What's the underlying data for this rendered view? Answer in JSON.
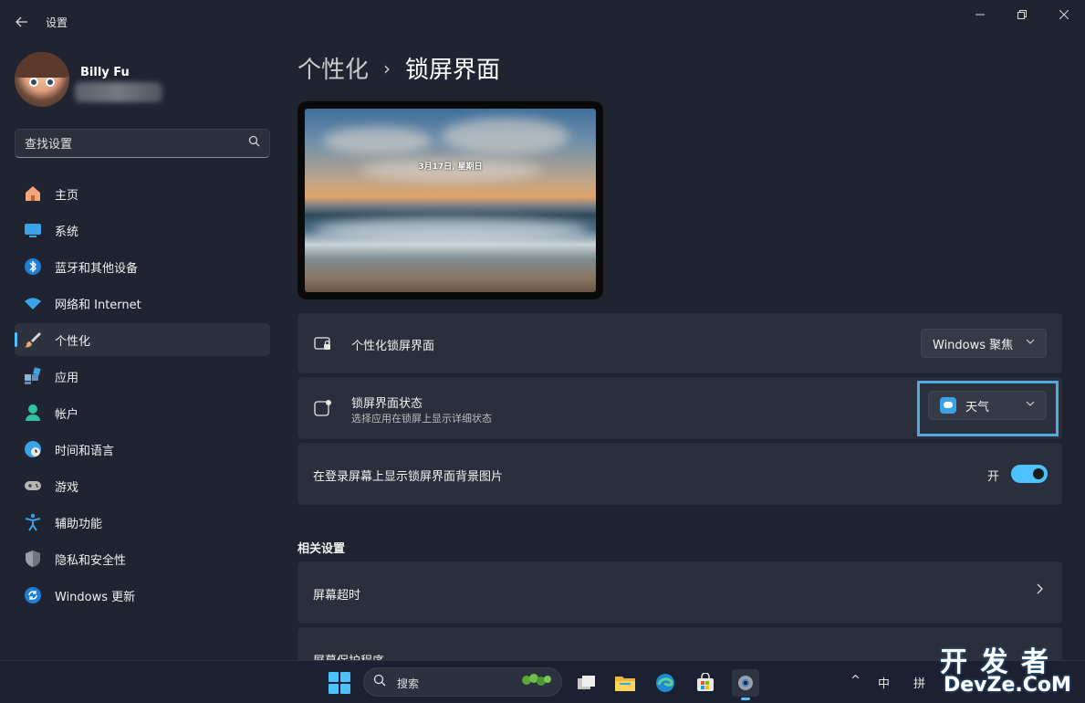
{
  "window": {
    "title": "设置",
    "back_icon": "arrow-left-icon",
    "minimize_icon": "minimize-icon",
    "maximize_icon": "restore-icon",
    "close_icon": "close-icon"
  },
  "user": {
    "name": "Billy Fu"
  },
  "search": {
    "placeholder": "查找设置",
    "icon": "search-icon"
  },
  "sidebar": {
    "items": [
      {
        "label": "主页",
        "icon": "home-icon"
      },
      {
        "label": "系统",
        "icon": "monitor-icon"
      },
      {
        "label": "蓝牙和其他设备",
        "icon": "bluetooth-icon"
      },
      {
        "label": "网络和 Internet",
        "icon": "wifi-icon"
      },
      {
        "label": "个性化",
        "icon": "brush-icon",
        "active": true
      },
      {
        "label": "应用",
        "icon": "apps-icon"
      },
      {
        "label": "帐户",
        "icon": "person-icon"
      },
      {
        "label": "时间和语言",
        "icon": "globe-clock-icon"
      },
      {
        "label": "游戏",
        "icon": "gamepad-icon"
      },
      {
        "label": "辅助功能",
        "icon": "accessibility-icon"
      },
      {
        "label": "隐私和安全性",
        "icon": "shield-icon"
      },
      {
        "label": "Windows 更新",
        "icon": "update-icon"
      }
    ]
  },
  "breadcrumb": {
    "parent": "个性化",
    "separator": "›",
    "current": "锁屏界面"
  },
  "preview": {
    "date_text": "3月17日, 星期日"
  },
  "settings": {
    "personalize_lock": {
      "title": "个性化锁屏界面",
      "icon": "lock-screen-icon",
      "value": "Windows 聚焦"
    },
    "lock_status": {
      "title": "锁屏界面状态",
      "subtitle": "选择应用在锁屏上显示详细状态",
      "icon": "status-icon",
      "value": "天气",
      "value_icon": "weather-icon"
    },
    "show_background": {
      "title": "在登录屏幕上显示锁屏界面背景图片",
      "toggle_label": "开",
      "toggle_on": true
    }
  },
  "related": {
    "section_title": "相关设置",
    "items": [
      {
        "label": "屏幕超时"
      },
      {
        "label": "屏幕保护程序"
      }
    ]
  },
  "taskbar": {
    "search_label": "搜索",
    "start_icon": "windows-start-icon",
    "apps": [
      "task-view-icon",
      "file-explorer-icon",
      "edge-icon",
      "store-icon",
      "settings-icon"
    ],
    "tray": {
      "chevron": "^",
      "ime_1": "中",
      "ime_2": "拼"
    }
  },
  "watermark": {
    "line1": "开 发 者",
    "line2": "DevZe.CoM"
  },
  "colors": {
    "accent": "#4cc2ff",
    "background": "#202431",
    "card": "#2b2f3b",
    "highlight": "#52a8e0"
  }
}
